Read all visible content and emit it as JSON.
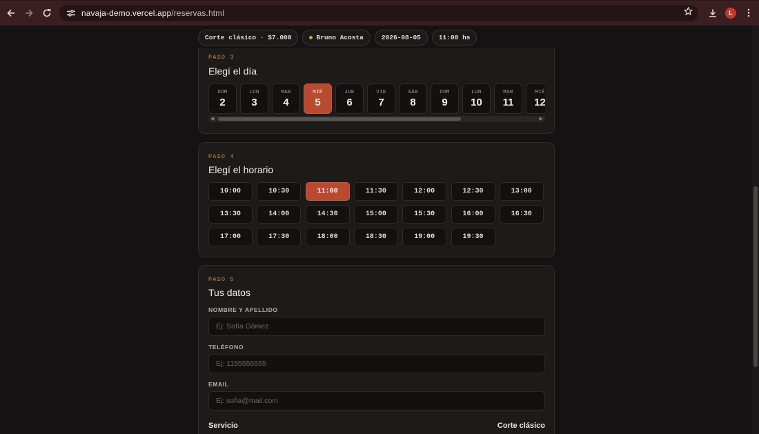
{
  "browser": {
    "url_host": "navaja-demo.vercel.app",
    "url_path": "/reservas.html",
    "profile_initial": "L",
    "icons": [
      "back-arrow-icon",
      "forward-arrow-icon",
      "reload-icon",
      "site-settings-icon",
      "star-icon",
      "download-icon",
      "kebab-menu-icon"
    ]
  },
  "summary": {
    "service": "Corte clásico · $7.000",
    "barber": "Bruno Acosta",
    "date": "2026-08-05",
    "time": "11:00 hs"
  },
  "step3": {
    "label": "PASO 3",
    "title": "Elegí el día",
    "days": [
      {
        "dow": "DOM",
        "num": "2"
      },
      {
        "dow": "LUN",
        "num": "3"
      },
      {
        "dow": "MAR",
        "num": "4"
      },
      {
        "dow": "MIÉ",
        "num": "5",
        "selected": true
      },
      {
        "dow": "JUE",
        "num": "6"
      },
      {
        "dow": "VIE",
        "num": "7"
      },
      {
        "dow": "SÁB",
        "num": "8"
      },
      {
        "dow": "DOM",
        "num": "9"
      },
      {
        "dow": "LUN",
        "num": "10"
      },
      {
        "dow": "MAR",
        "num": "11"
      },
      {
        "dow": "MIÉ",
        "num": "12"
      }
    ]
  },
  "step4": {
    "label": "PASO 4",
    "title": "Elegí el horario",
    "slots": [
      "10:00",
      "10:30",
      "11:00",
      "11:30",
      "12:00",
      "12:30",
      "13:00",
      "13:30",
      "14:00",
      "14:30",
      "15:00",
      "15:30",
      "16:00",
      "16:30",
      "17:00",
      "17:30",
      "18:00",
      "18:30",
      "19:00",
      "19:30"
    ],
    "selected": "11:00"
  },
  "step5": {
    "label": "PASO 5",
    "title": "Tus datos",
    "name_label": "NOMBRE Y APELLIDO",
    "name_placeholder": "Ej: Sofía Gómez",
    "phone_label": "TELÉFONO",
    "phone_placeholder": "Ej: 1155555555",
    "email_label": "EMAIL",
    "email_placeholder": "Ej: sofia@mail.com",
    "service_label": "Servicio",
    "service_value": "Corte clásico"
  },
  "colors": {
    "accent": "#b84a32",
    "step_label": "#c98b3e",
    "chrome": "#3a1f22",
    "background": "#141212"
  }
}
